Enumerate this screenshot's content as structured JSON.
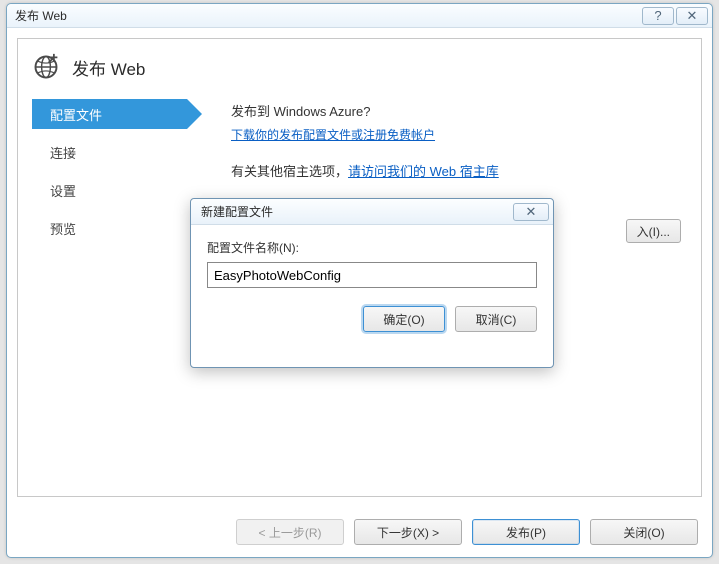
{
  "window": {
    "title": "发布 Web",
    "help_glyph": "?",
    "close_glyph": "✕"
  },
  "header": {
    "title": "发布 Web"
  },
  "nav": {
    "items": [
      {
        "label": "配置文件",
        "active": true
      },
      {
        "label": "连接",
        "active": false
      },
      {
        "label": "设置",
        "active": false
      },
      {
        "label": "预览",
        "active": false
      }
    ]
  },
  "content": {
    "azure_question": "发布到 Windows Azure?",
    "download_link": "下载你的发布配置文件或注册免费帐户",
    "other_host_prefix": "有关其他宿主选项，",
    "other_host_link": "请访问我们的 Web 宿主库",
    "import_button": "入(I)..."
  },
  "footer": {
    "prev": "< 上一步(R)",
    "next": "下一步(X) >",
    "publish": "发布(P)",
    "close": "关闭(O)"
  },
  "dialog": {
    "title": "新建配置文件",
    "close_glyph": "✕",
    "label": "配置文件名称(N):",
    "value": "EasyPhotoWebConfig",
    "ok": "确定(O)",
    "cancel": "取消(C)"
  }
}
